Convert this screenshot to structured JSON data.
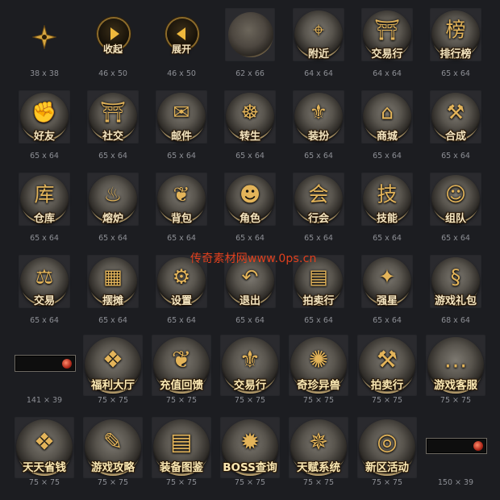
{
  "colors": {
    "background": "#1c1d21",
    "gold": "#e3b45a",
    "label_text": "#f5e6c1",
    "dimension_text": "#8d8f95",
    "watermark": "#e0401e"
  },
  "watermark": "传奇素材网www.0ps.cn",
  "row1": {
    "shuriken": {
      "icon": "shuriken-icon",
      "dim": "38 x 38"
    },
    "collapse": {
      "label": "收起",
      "icon": "arrow-right-icon",
      "dim": "46 x 50"
    },
    "expand": {
      "label": "展开",
      "icon": "arrow-left-icon",
      "dim": "46 x 50"
    },
    "blank": {
      "icon": "stone-disc-icon",
      "dim": "62 x 66"
    },
    "items": [
      {
        "label": "附近",
        "icon": "map-pin-icon",
        "dim": "64 x 64"
      },
      {
        "label": "交易行",
        "icon": "pavilion-icon",
        "dim": "64 x 64"
      },
      {
        "label": "排行榜",
        "icon": "ranking-scroll-icon",
        "dim": "65 x 64"
      }
    ]
  },
  "row2": [
    {
      "label": "好友",
      "icon": "handshake-icon",
      "dim": "65 x 64"
    },
    {
      "label": "社交",
      "icon": "gate-icon",
      "dim": "65 x 64"
    },
    {
      "label": "邮件",
      "icon": "mail-icon",
      "dim": "65 x 64"
    },
    {
      "label": "转生",
      "icon": "meditating-figure-icon",
      "dim": "65 x 64"
    },
    {
      "label": "装扮",
      "icon": "robe-icon",
      "dim": "65 x 64"
    },
    {
      "label": "商城",
      "icon": "shop-icon",
      "dim": "65 x 64"
    },
    {
      "label": "合成",
      "icon": "anvil-hammer-icon",
      "dim": "65 x 64"
    }
  ],
  "row3": [
    {
      "label": "仓库",
      "icon": "warehouse-icon",
      "dim": "65 x 64"
    },
    {
      "label": "熔炉",
      "icon": "furnace-icon",
      "dim": "65 x 64"
    },
    {
      "label": "背包",
      "icon": "bag-icon",
      "dim": "65 x 64"
    },
    {
      "label": "角色",
      "icon": "warrior-portrait-icon",
      "dim": "65 x 64"
    },
    {
      "label": "行会",
      "icon": "guild-emblem-icon",
      "dim": "65 x 64"
    },
    {
      "label": "技能",
      "icon": "skill-book-icon",
      "dim": "65 x 64"
    },
    {
      "label": "组队",
      "icon": "team-portrait-icon",
      "dim": "65 x 64"
    }
  ],
  "row4": [
    {
      "label": "交易",
      "icon": "scales-icon",
      "dim": "65 x 64"
    },
    {
      "label": "摆摊",
      "icon": "stall-icon",
      "dim": "65 x 64"
    },
    {
      "label": "设置",
      "icon": "gear-icon",
      "dim": "65 x 64"
    },
    {
      "label": "退出",
      "icon": "exit-arrow-icon",
      "dim": "65 x 64"
    },
    {
      "label": "拍卖行",
      "icon": "auction-book-icon",
      "dim": "65 x 64"
    },
    {
      "label": "强星",
      "icon": "star-cube-icon",
      "dim": "65 x 64"
    },
    {
      "label": "游戏礼包",
      "icon": "dragon-icon",
      "dim": "68 x 64"
    }
  ],
  "row5": {
    "bar": {
      "dim": "141 × 39"
    },
    "items": [
      {
        "label": "福利大厅",
        "icon": "gift-box-icon",
        "dim": "75 × 75"
      },
      {
        "label": "充值回馈",
        "icon": "money-bag-icon",
        "dim": "75 × 75"
      },
      {
        "label": "交易行",
        "icon": "trade-emblem-icon",
        "dim": "75 × 75"
      },
      {
        "label": "奇珍异兽",
        "icon": "beast-icon",
        "dim": "75 × 75"
      },
      {
        "label": "拍卖行",
        "icon": "gavel-icon",
        "dim": "75 × 75"
      },
      {
        "label": "游戏客服",
        "icon": "chat-bubble-icon",
        "dim": "75 × 75"
      }
    ]
  },
  "row6": {
    "items": [
      {
        "label": "天天省钱",
        "icon": "gift-pile-icon",
        "dim": "75 × 75"
      },
      {
        "label": "游戏攻略",
        "icon": "scroll-icon",
        "dim": "75 × 75"
      },
      {
        "label": "装备图鉴",
        "icon": "book-icon",
        "dim": "75 × 75"
      },
      {
        "label": "BOSS查询",
        "icon": "boss-emblem-icon",
        "dim": "75 × 75"
      },
      {
        "label": "天赋系统",
        "icon": "talent-emblem-icon",
        "dim": "75 × 75"
      },
      {
        "label": "新区活动",
        "icon": "drum-icon",
        "dim": "75 × 75"
      }
    ],
    "bar": {
      "dim": "150 × 39"
    }
  }
}
